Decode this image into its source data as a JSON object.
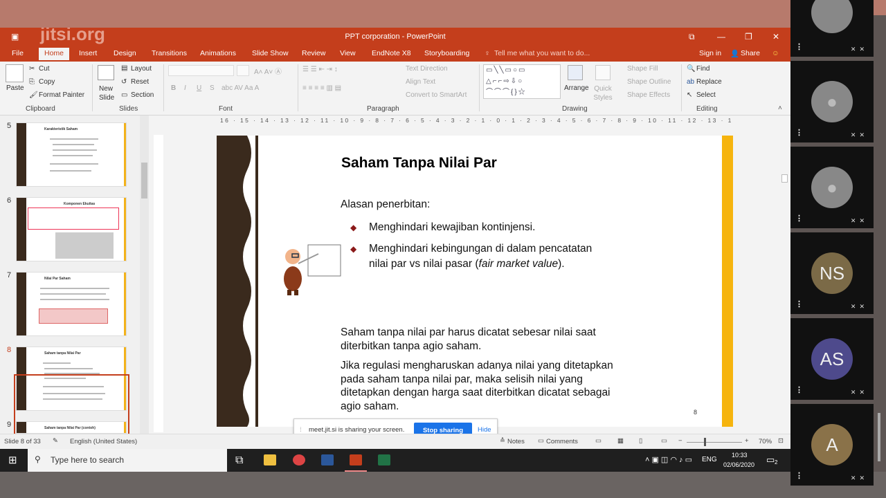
{
  "window": {
    "title": "PPT corporation - PowerPoint",
    "sign_in": "Sign in",
    "share": "Share"
  },
  "watermark": "jitsi.org",
  "tabs": [
    "File",
    "Home",
    "Insert",
    "Design",
    "Transitions",
    "Animations",
    "Slide Show",
    "Review",
    "View",
    "EndNote X8",
    "Storyboarding"
  ],
  "tell_me": "Tell me what you want to do...",
  "ribbon": {
    "clipboard": {
      "paste": "Paste",
      "cut": "Cut",
      "copy": "Copy",
      "format_painter": "Format Painter",
      "label": "Clipboard"
    },
    "slides": {
      "new_slide": "New Slide",
      "layout": "Layout",
      "reset": "Reset",
      "section": "Section",
      "label": "Slides"
    },
    "font": {
      "label": "Font",
      "bold": "B",
      "italic": "I",
      "underline": "U",
      "strike": "S"
    },
    "paragraph": {
      "label": "Paragraph",
      "text_direction": "Text Direction",
      "align_text": "Align Text",
      "convert": "Convert to SmartArt"
    },
    "drawing": {
      "label": "Drawing",
      "arrange": "Arrange",
      "quick_styles": "Quick Styles",
      "shape_fill": "Shape Fill",
      "shape_outline": "Shape Outline",
      "shape_effects": "Shape Effects"
    },
    "editing": {
      "label": "Editing",
      "find": "Find",
      "replace": "Replace",
      "select": "Select"
    }
  },
  "ruler": "16 · 15 · 14 · 13 · 12 · 11 · 10 · 9 · 8 · 7 · 6 · 5 · 4 · 3 · 2 · 1 · 0 · 1 · 2 · 3 · 4 · 5 · 6 · 7 · 8 · 9 · 10 · 11 · 12 · 13 · 14 · 15 · 16",
  "thumbnails": [
    {
      "num": "5",
      "title": "Karakteristik Saham"
    },
    {
      "num": "6",
      "title": "Komponen Ekuitas"
    },
    {
      "num": "7",
      "title": "Nilai Par Saham"
    },
    {
      "num": "8",
      "title": "Saham tanpa Nilai Par"
    },
    {
      "num": "9",
      "title": "Saham tanpa Nilai Par (contoh)"
    }
  ],
  "slide": {
    "title": "Saham Tanpa Nilai Par",
    "intro": "Alasan penerbitan:",
    "bullet1": "Menghindari kewajiban kontinjensi.",
    "bullet2_line1": "Menghindari kebingungan di dalam pencatatan",
    "bullet2_line2_a": "nilai par vs nilai pasar (",
    "bullet2_line2_italic": "fair market value",
    "bullet2_line2_b": ").",
    "para1": "Saham tanpa nilai par harus dicatat sebesar nilai saat diterbitkan tanpa agio saham.",
    "para2": "Jika regulasi mengharuskan adanya nilai yang ditetapkan pada saham tanpa nilai par, maka selisih nilai yang ditetapkan dengan harga saat diterbitkan dicatat sebagai agio saham.",
    "page": "8"
  },
  "status": {
    "slide_info": "Slide 8 of 33",
    "language": "English (United States)",
    "notes": "Notes",
    "comments": "Comments",
    "zoom": "70%"
  },
  "share_bar": {
    "text": "meet.jit.si is sharing your screen.",
    "stop": "Stop sharing",
    "hide": "Hide"
  },
  "taskbar": {
    "search": "Type here to search",
    "lang": "ENG",
    "time": "10:33",
    "date": "02/06/2020",
    "notif": "2"
  },
  "participants": [
    "",
    "",
    "NS",
    "AS",
    "A"
  ],
  "colors": {
    "accent": "#c43e1c",
    "slide_bar": "#f6b40e",
    "ns": "#7b6a47",
    "as": "#4e4a8c",
    "a": "#8a7249"
  }
}
